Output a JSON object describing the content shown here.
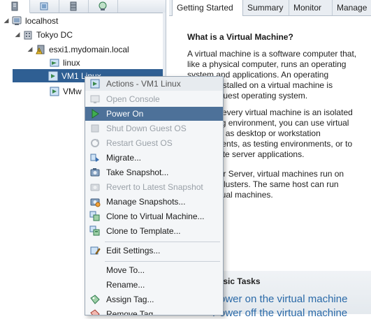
{
  "view_tabs": [
    {
      "name": "hosts-clusters-icon"
    },
    {
      "name": "vms-templates-icon"
    },
    {
      "name": "storage-icon"
    },
    {
      "name": "networking-icon"
    }
  ],
  "tree": {
    "localhost": "localhost",
    "datacenter": "Tokyo DC",
    "host": "esxi1.mydomain.local",
    "folder": "linux",
    "vm_selected": "VM1 Linux",
    "vm_partial": "VMw"
  },
  "tabs": [
    "Getting Started",
    "Summary",
    "Monitor",
    "Manage"
  ],
  "content": {
    "heading": "What is a Virtual Machine?",
    "para1": [
      "A virtual machine is a software computer that,",
      "like a physical computer, runs an operating",
      "system and applications. An operating",
      "system installed on a virtual machine is",
      "called a guest operating system."
    ],
    "para2": [
      "Because every virtual machine is an isolated",
      "computing environment, you can use virtual",
      "machines as desktop or workstation",
      "environments, as testing environments, or to",
      "consolidate server applications."
    ],
    "para3": [
      "In vCenter Server, virtual machines run on",
      "hosts or clusters. The same host can run",
      "many virtual machines."
    ],
    "tasks_title": "Basic Tasks",
    "task1": "Power on the virtual machine",
    "task2": "Power off the virtual machine"
  },
  "menu": {
    "header": "Actions - VM1 Linux",
    "items": [
      {
        "label": "Open Console",
        "icon": "console-icon",
        "state": "disabled"
      },
      {
        "label": "Power On",
        "icon": "power-on-icon",
        "state": "highlight"
      },
      {
        "label": "Shut Down Guest OS",
        "icon": "shutdown-icon",
        "state": "disabled"
      },
      {
        "label": "Restart Guest OS",
        "icon": "restart-icon",
        "state": "disabled"
      },
      {
        "label": "Migrate...",
        "icon": "migrate-icon",
        "state": "enabled"
      },
      {
        "label": "Take Snapshot...",
        "icon": "snapshot-icon",
        "state": "enabled"
      },
      {
        "label": "Revert to Latest Snapshot",
        "icon": "revert-snapshot-icon",
        "state": "disabled"
      },
      {
        "label": "Manage Snapshots...",
        "icon": "manage-snapshots-icon",
        "state": "enabled"
      },
      {
        "label": "Clone to Virtual Machine...",
        "icon": "clone-vm-icon",
        "state": "enabled"
      },
      {
        "label": "Clone to Template...",
        "icon": "clone-template-icon",
        "state": "enabled"
      },
      {
        "label": "Edit Settings...",
        "icon": "edit-settings-icon",
        "state": "enabled"
      },
      {
        "label": "Move To...",
        "icon": "",
        "state": "enabled"
      },
      {
        "label": "Rename...",
        "icon": "",
        "state": "enabled"
      },
      {
        "label": "Assign Tag...",
        "icon": "assign-tag-icon",
        "state": "enabled"
      },
      {
        "label": "Remove Tag...",
        "icon": "remove-tag-icon",
        "state": "enabled"
      }
    ]
  },
  "colors": {
    "selection": "#2f5f93",
    "menu_highlight": "#4d7199",
    "link": "#2b6aa8"
  }
}
